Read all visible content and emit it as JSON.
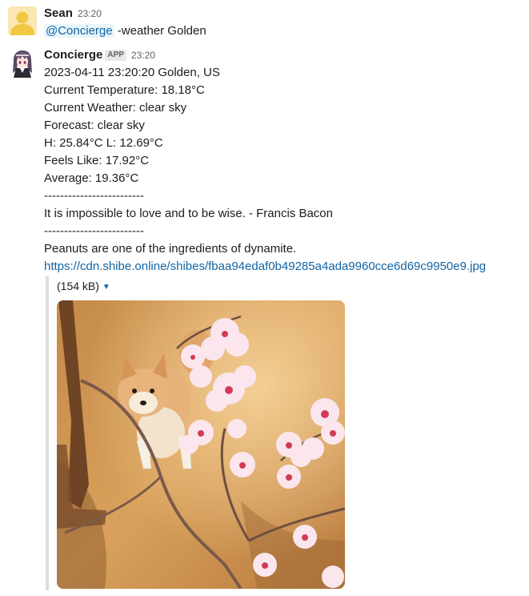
{
  "messages": [
    {
      "author": "Sean",
      "time": "23:20",
      "mention": "@Concierge",
      "text": " -weather Golden"
    },
    {
      "author": "Concierge",
      "badge": "APP",
      "time": "23:20",
      "lines": [
        "2023-04-11 23:20:20 Golden, US",
        "Current Temperature: 18.18°C",
        "Current Weather: clear sky",
        "Forecast: clear sky",
        "H: 25.84°C L: 12.69°C",
        "Feels Like: 17.92°C",
        "Average: 19.36°C",
        "-------------------------",
        "It is impossible to love and to be wise. - Francis Bacon",
        "-------------------------",
        "Peanuts are one of the ingredients of dynamite."
      ],
      "link": "https://cdn.shibe.online/shibes/fbaa94edaf0b49285a4ada9960cce6d69c9950e9.jpg",
      "attachment": {
        "size": "(154 kB)"
      }
    }
  ],
  "colors": {
    "link": "#1264a3",
    "mention_bg": "#e8f5fa",
    "sean_avatar": "#f2c744",
    "attachment_border": "#dddddd"
  },
  "icons": {
    "sean_avatar": "default-user-avatar-icon",
    "concierge_avatar": "anime-character-avatar",
    "caret": "caret-down-icon"
  }
}
